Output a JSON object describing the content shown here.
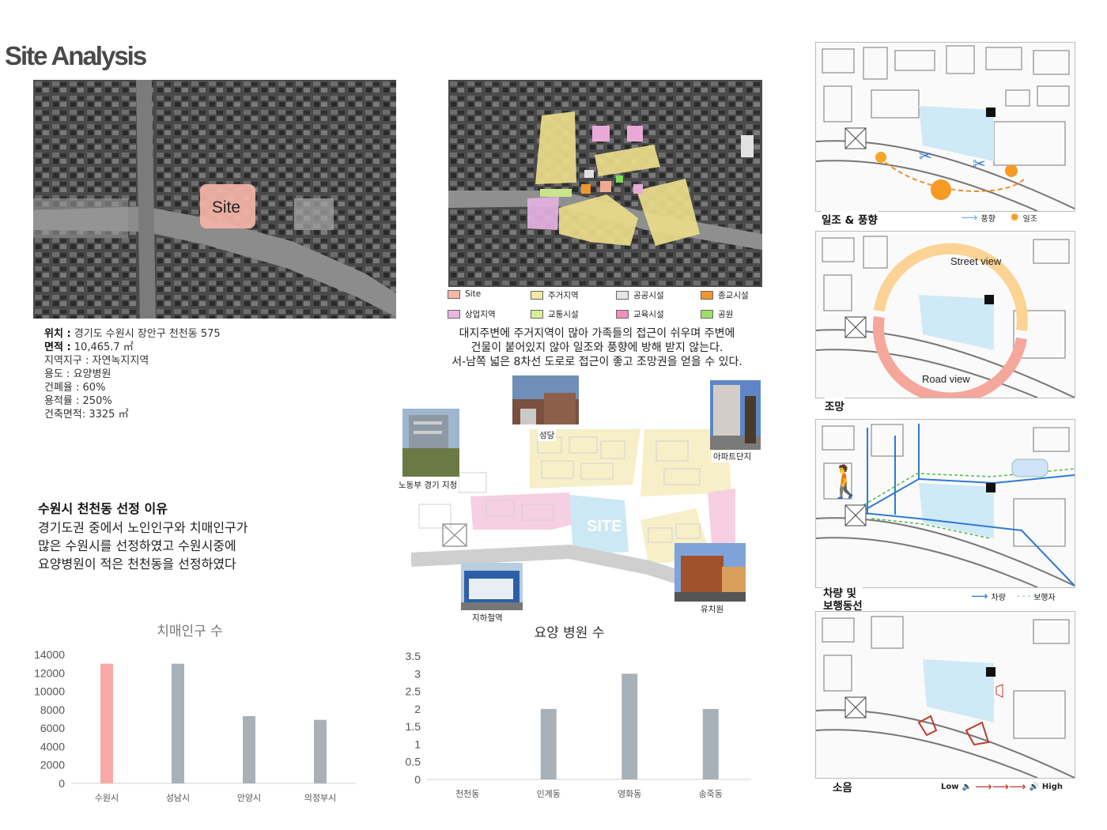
{
  "title": "Site Analysis",
  "aerial": {
    "site_label": "Site"
  },
  "site_info": {
    "location_label": "위치 :",
    "location_value": " 경기도 수원시 장안구 천천동 575",
    "area_label": "면적 :",
    "area_value": " 10,465.7 ㎡",
    "zone": "지역지구 : 자연녹지지역",
    "use": "용도 : 요양병원",
    "coverage": "건폐율 : 60%",
    "far": "용적률 : 250%",
    "building_area": "건축면적: 3325 ㎡"
  },
  "zoning_legend": [
    {
      "label": "Site",
      "color": "#f6b7a6"
    },
    {
      "label": "주거지역",
      "color": "#f1e9a4"
    },
    {
      "label": "공공시설",
      "color": "#e6e6e6"
    },
    {
      "label": "종교시설",
      "color": "#f0962f"
    },
    {
      "label": "상업지역",
      "color": "#e9b6e2"
    },
    {
      "label": "교통시설",
      "color": "#d8ef9a"
    },
    {
      "label": "교육시설",
      "color": "#ef8fbd"
    },
    {
      "label": "공원",
      "color": "#9be06b"
    }
  ],
  "zoning_desc": [
    "대지주변에 주거지역이 많아 가족들의 접근이 쉬우며 주변에",
    "건물이 붙어있지 않아 일조와 풍향에 방해 받지 않는다.",
    "서-남쪽 넓은 8차선 도로로 접근이 좋고 조망권을 얻을 수 있다."
  ],
  "context_map": {
    "site_label": "SITE",
    "photos": {
      "church": "성당",
      "labor": "노동부 경기 지청",
      "apartment": "아파트단지",
      "subway": "지하철역",
      "kinder": "유치원"
    }
  },
  "reason": {
    "heading": "수원시 천천동 선정 이유",
    "lines": [
      "경기도권 중에서 노인인구와 치매인구가",
      "많은 수원시를 선정하였고 수원시중에",
      "요양병원이 적은 천천동을 선정하였다"
    ]
  },
  "chart_data": [
    {
      "type": "bar",
      "title": "치매인구 수",
      "categories": [
        "수원시",
        "성남시",
        "안양시",
        "의정부시"
      ],
      "values": [
        13000,
        13000,
        7300,
        6900
      ],
      "ylim": [
        0,
        14000
      ],
      "yticks": [
        0,
        2000,
        4000,
        6000,
        8000,
        10000,
        12000,
        14000
      ],
      "colors": [
        "#f7aaa5",
        "#a9b1b8",
        "#a9b1b8",
        "#a9b1b8"
      ],
      "grid": false
    },
    {
      "type": "bar",
      "title": "요양 병원 수",
      "categories": [
        "천천동",
        "인계동",
        "영화동",
        "송죽동"
      ],
      "values": [
        0,
        2,
        3,
        2
      ],
      "ylim": [
        0,
        3.5
      ],
      "yticks": [
        "0",
        "0.5",
        "1",
        "1.5",
        "2",
        "2.5",
        "3",
        "3.5"
      ],
      "colors": [
        "#a9b1b8",
        "#a9b1b8",
        "#a9b1b8",
        "#a9b1b8"
      ],
      "grid": false
    }
  ],
  "panels": {
    "sun": {
      "label": "일조 & 풍향",
      "legend_wind": "풍향",
      "legend_sun": "일조"
    },
    "view": {
      "label": "조망",
      "street_view": "Street view",
      "road_view": "Road view"
    },
    "traffic": {
      "label_line1": "차량 및",
      "label_line2": "보행동선",
      "legend_car": "차량",
      "legend_ped": "보행자"
    },
    "noise": {
      "label": "소음",
      "low": "Low",
      "high": "High"
    }
  }
}
